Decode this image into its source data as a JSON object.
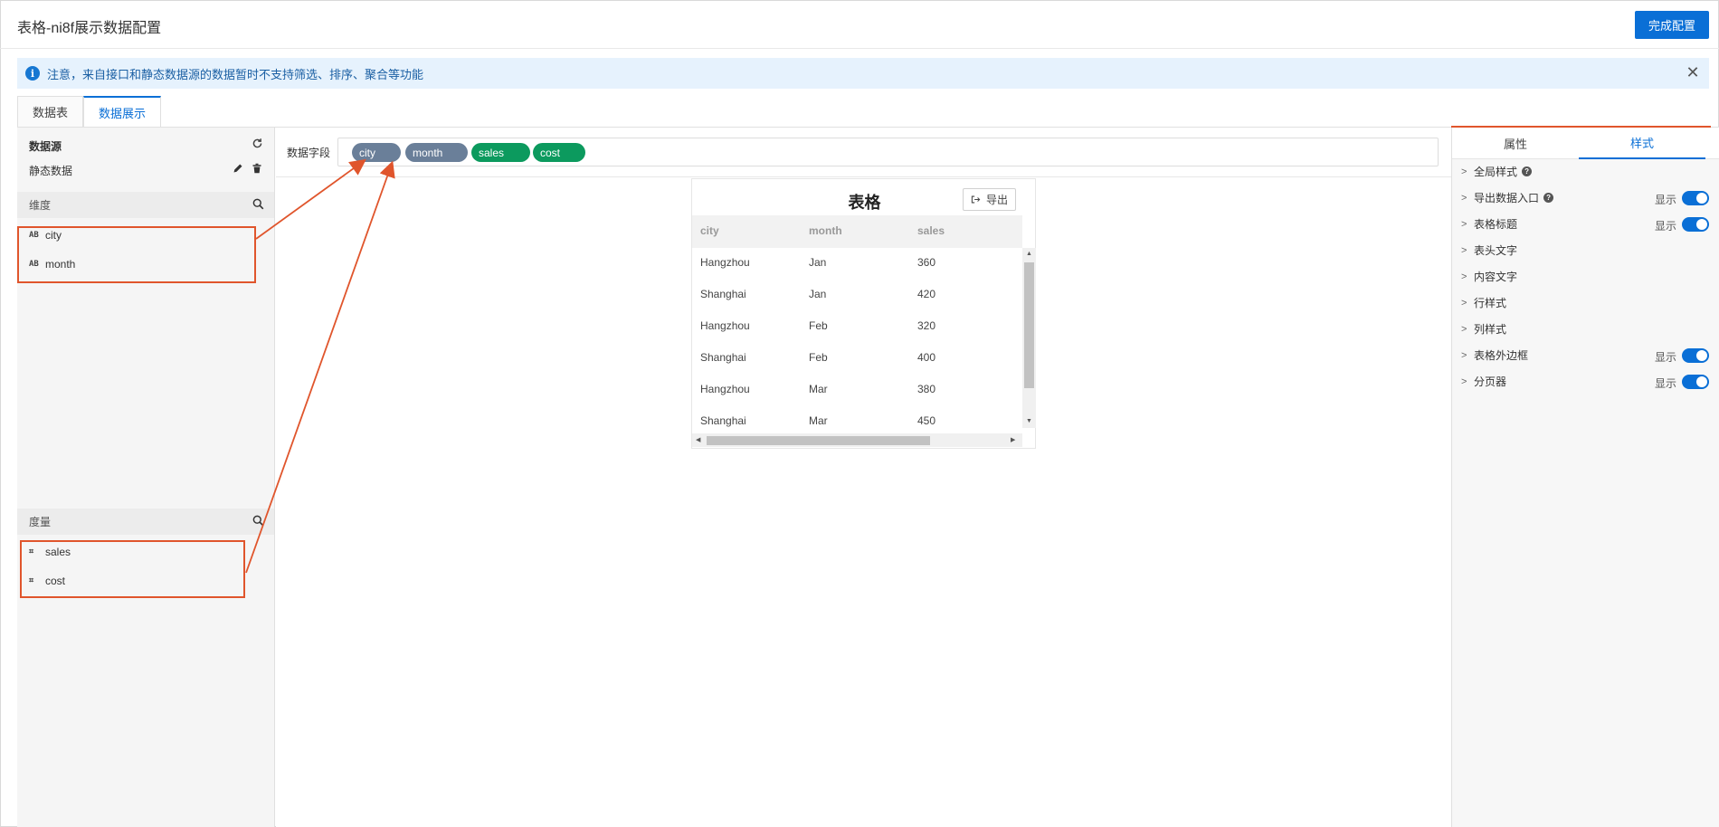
{
  "header": {
    "title": "表格-ni8f展示数据配置",
    "finish_label": "完成配置"
  },
  "notice": {
    "text": "注意，来自接口和静态数据源的数据暂时不支持筛选、排序、聚合等功能"
  },
  "tabs": [
    {
      "label": "数据表"
    },
    {
      "label": "数据展示"
    }
  ],
  "left": {
    "datasource_title": "数据源",
    "datasource_name": "静态数据",
    "dimension_title": "维度",
    "measure_title": "度量",
    "dimensions": [
      {
        "type": "AB",
        "name": "city"
      },
      {
        "type": "AB",
        "name": "month"
      }
    ],
    "measures": [
      {
        "type": "⌗",
        "name": "sales"
      },
      {
        "type": "⌗",
        "name": "cost"
      }
    ]
  },
  "fields": {
    "label": "数据字段",
    "pills": [
      {
        "name": "city",
        "kind": "dimension"
      },
      {
        "name": "month",
        "kind": "dimension"
      },
      {
        "name": "sales",
        "kind": "measure"
      },
      {
        "name": "cost",
        "kind": "measure"
      }
    ]
  },
  "table": {
    "title": "表格",
    "export_label": "导出",
    "columns": [
      "city",
      "month",
      "sales"
    ],
    "rows": [
      [
        "Hangzhou",
        "Jan",
        "360"
      ],
      [
        "Shanghai",
        "Jan",
        "420"
      ],
      [
        "Hangzhou",
        "Feb",
        "320"
      ],
      [
        "Shanghai",
        "Feb",
        "400"
      ],
      [
        "Hangzhou",
        "Mar",
        "380"
      ],
      [
        "Shanghai",
        "Mar",
        "450"
      ]
    ]
  },
  "right": {
    "tabs": [
      {
        "label": "属性"
      },
      {
        "label": "样式"
      }
    ],
    "settings": [
      {
        "label": "全局样式",
        "help": true
      },
      {
        "label": "导出数据入口",
        "help": true,
        "show": "显示"
      },
      {
        "label": "表格标题",
        "show": "显示"
      },
      {
        "label": "表头文字"
      },
      {
        "label": "内容文字"
      },
      {
        "label": "行样式"
      },
      {
        "label": "列样式"
      },
      {
        "label": "表格外边框",
        "show": "显示"
      },
      {
        "label": "分页器",
        "show": "显示"
      }
    ]
  },
  "colors": {
    "accent": "#0a6fd6",
    "dimension_pill": "#6a7f99",
    "measure_pill": "#0c9a5e",
    "highlight": "#e0552c"
  }
}
